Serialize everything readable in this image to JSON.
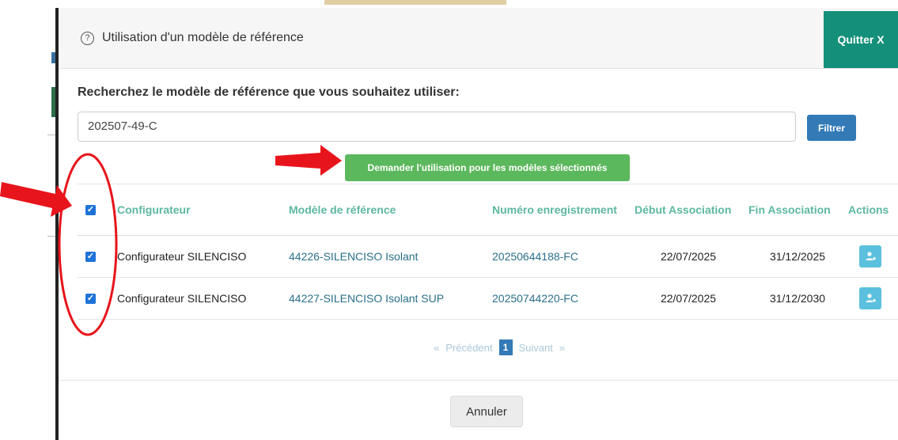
{
  "modal": {
    "title": "Utilisation d'un modèle de référence",
    "help_icon": "?",
    "quit_label": "Quitter X"
  },
  "search": {
    "label": "Recherchez le modèle de référence que vous souhaitez utiliser:",
    "value": "202507-49-C",
    "filter_label": "Filtrer"
  },
  "request_button": "Demander l'utilisation pour les modèles sélectionnés",
  "table": {
    "columns": [
      "Configurateur",
      "Modèle de référence",
      "Numéro enregistrement",
      "Début Association",
      "Fin Association",
      "Actions"
    ],
    "rows": [
      {
        "selected": true,
        "configurateur": "Configurateur SILENCISO",
        "modele": "44226-SILENCISO Isolant",
        "numero": "20250644188-FC",
        "debut": "22/07/2025",
        "fin": "31/12/2025"
      },
      {
        "selected": true,
        "configurateur": "Configurateur SILENCISO",
        "modele": "44227-SILENCISO Isolant SUP",
        "numero": "20250744220-FC",
        "debut": "22/07/2025",
        "fin": "31/12/2030"
      }
    ]
  },
  "pagination": {
    "first": "«",
    "previous": "Précédent",
    "current": "1",
    "next": "Suivant",
    "last": "»"
  },
  "footer": {
    "cancel_label": "Annuler"
  },
  "colors": {
    "quit_bg": "#14907a",
    "filter_bg": "#337ab7",
    "request_bg": "#5cb85c",
    "header_text": "#5cb8a0",
    "action_bg": "#5bc0de",
    "annotation": "#e8141b"
  },
  "icons": {
    "help": "question-circle-icon",
    "action": "user-add-icon",
    "checkbox": "checkbox-checked-icon",
    "arrow": "red-arrow-icon"
  }
}
